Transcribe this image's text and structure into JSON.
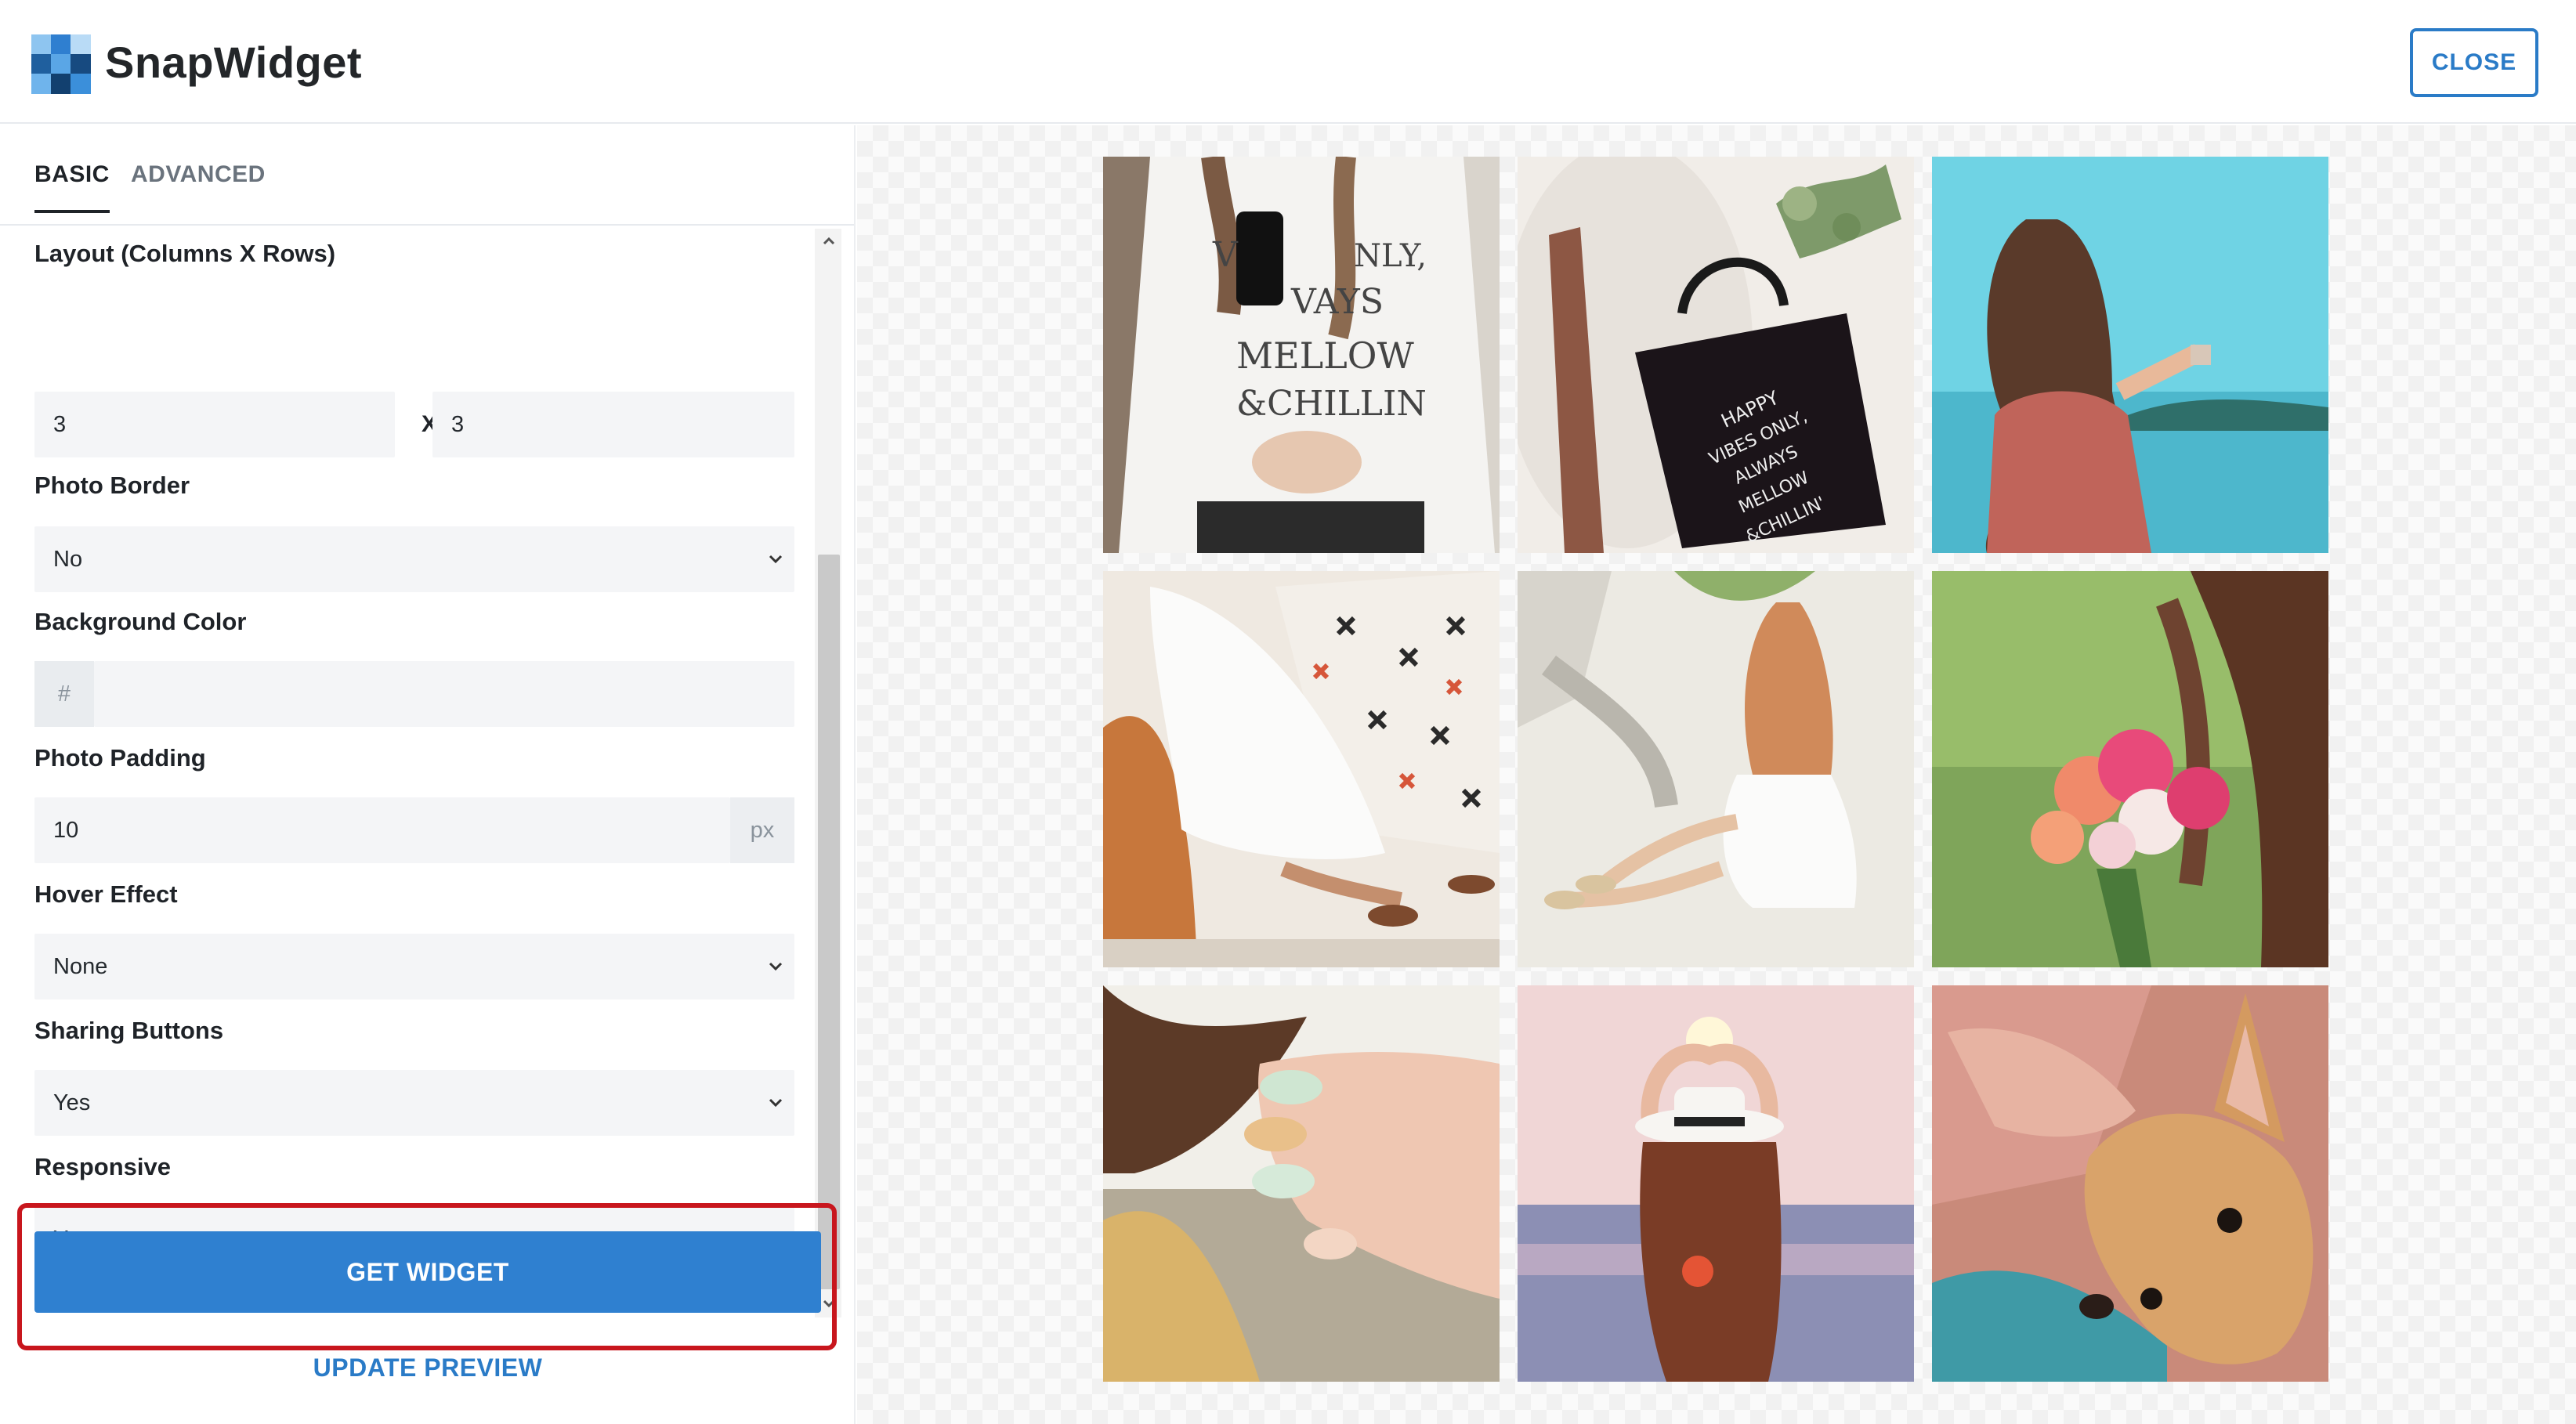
{
  "app": {
    "brand": "SnapWidget",
    "close_label": "CLOSE"
  },
  "tabs": [
    {
      "label": "BASIC",
      "active": true
    },
    {
      "label": "ADVANCED",
      "active": false
    }
  ],
  "form": {
    "layout": {
      "label": "Layout (Columns X Rows)",
      "columns": "3",
      "separator": "X",
      "rows": "3"
    },
    "photo_border": {
      "label": "Photo Border",
      "value": "No"
    },
    "background_color": {
      "label": "Background Color",
      "prefix": "#",
      "value": ""
    },
    "photo_padding": {
      "label": "Photo Padding",
      "value": "10",
      "unit": "px"
    },
    "hover_effect": {
      "label": "Hover Effect",
      "value": "None"
    },
    "sharing_buttons": {
      "label": "Sharing Buttons",
      "value": "Yes"
    },
    "responsive": {
      "label": "Responsive",
      "value": "Yes"
    }
  },
  "actions": {
    "get_widget": "GET WIDGET",
    "update_preview": "UPDATE PREVIEW"
  },
  "preview": {
    "photos": [
      {
        "subject": "white sweatshirt with phone"
      },
      {
        "subject": "black tote bag on fur"
      },
      {
        "subject": "woman at sea with camera"
      },
      {
        "subject": "white dress on patterned blanket"
      },
      {
        "subject": "woman sitting on sand"
      },
      {
        "subject": "woman holding bouquet"
      },
      {
        "subject": "hand with painted nails in hair"
      },
      {
        "subject": "woman in hat heart hands at sunset"
      },
      {
        "subject": "chihuahua puppy"
      }
    ]
  },
  "colors": {
    "accent": "#2f80d0",
    "highlight_border": "#c8161d"
  }
}
